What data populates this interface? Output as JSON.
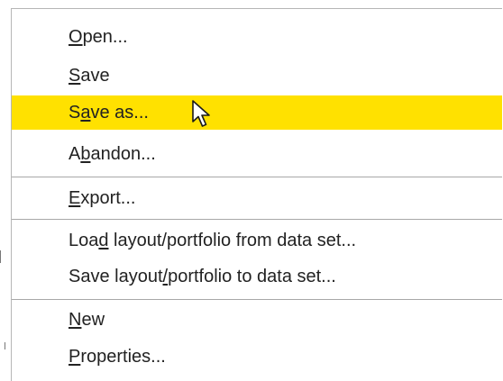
{
  "menu": {
    "items": [
      {
        "label": "Open...",
        "mnemonic_index": 0,
        "highlighted": false
      },
      {
        "label": "Save",
        "mnemonic_index": 0,
        "highlighted": false
      },
      {
        "label": "Save as...",
        "mnemonic_index": 1,
        "highlighted": true
      },
      {
        "label": "Abandon...",
        "mnemonic_index": 1,
        "highlighted": false
      },
      {
        "label": "Export...",
        "mnemonic_index": 0,
        "highlighted": false
      },
      {
        "label": "Load layout/portfolio from data set...",
        "mnemonic_index": 3,
        "highlighted": false
      },
      {
        "label": "Save layout/portfolio to data set...",
        "mnemonic_index": 11,
        "highlighted": false
      },
      {
        "label": "New",
        "mnemonic_index": 0,
        "highlighted": false
      },
      {
        "label": "Properties...",
        "mnemonic_index": 0,
        "highlighted": false
      }
    ]
  },
  "colors": {
    "highlight": "#ffe100",
    "text": "#222222",
    "separator": "#a8a8a8"
  },
  "cursor_icon": "arrow-cursor-icon"
}
